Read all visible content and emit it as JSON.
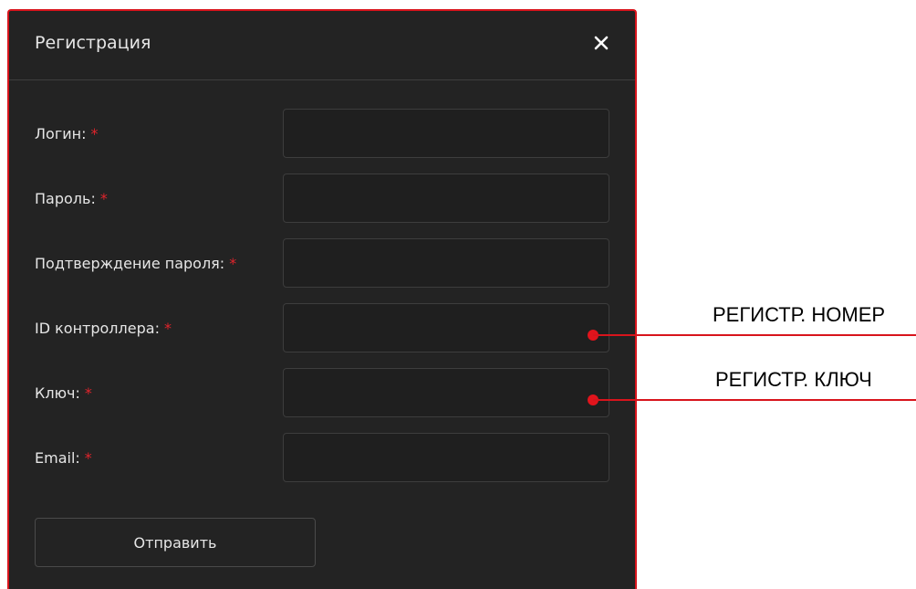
{
  "dialog": {
    "title": "Регистрация",
    "close_icon": "close-icon",
    "fields": [
      {
        "label": "Логин:",
        "required": "*",
        "value": ""
      },
      {
        "label": "Пароль:",
        "required": "*",
        "value": ""
      },
      {
        "label": "Подтверждение пароля:",
        "required": "*",
        "value": ""
      },
      {
        "label": "ID контроллера:",
        "required": "*",
        "value": ""
      },
      {
        "label": "Ключ:",
        "required": "*",
        "value": ""
      },
      {
        "label": "Email:",
        "required": "*",
        "value": ""
      }
    ],
    "submit_label": "Отправить"
  },
  "annotations": [
    {
      "text": "РЕГИСТР. НОМЕР"
    },
    {
      "text": "РЕГИСТР. КЛЮЧ"
    }
  ],
  "colors": {
    "dialog_bg": "#232323",
    "border_accent": "#d8141c",
    "required_marker": "#e0242c",
    "text": "#e6e6e6"
  }
}
